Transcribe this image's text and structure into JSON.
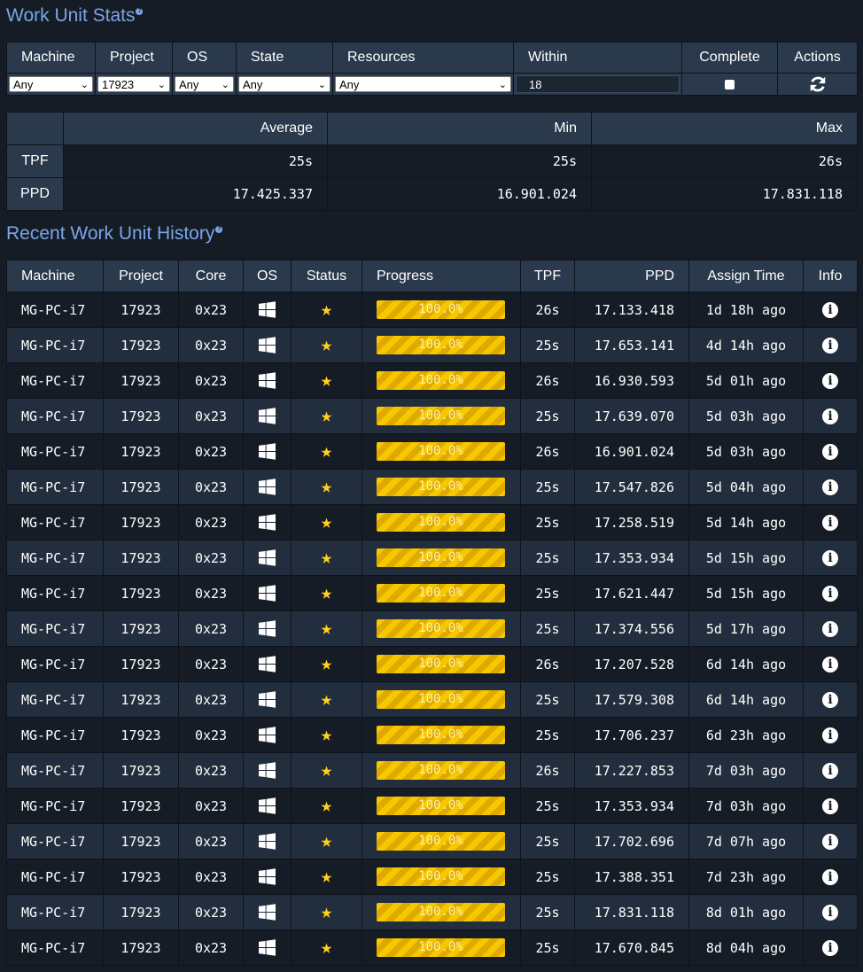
{
  "stats_section": {
    "title": "Work Unit Stats"
  },
  "filters": {
    "headers": {
      "machine": "Machine",
      "project": "Project",
      "os": "OS",
      "state": "State",
      "resources": "Resources",
      "within": "Within",
      "complete": "Complete",
      "actions": "Actions"
    },
    "values": {
      "machine": "Any",
      "project": "17923",
      "os": "Any",
      "state": "Any",
      "resources": "Any",
      "within": "18"
    },
    "complete_checked": false
  },
  "stats": {
    "headers": {
      "average": "Average",
      "min": "Min",
      "max": "Max"
    },
    "rows": [
      {
        "label": "TPF",
        "average": "25s",
        "min": "25s",
        "max": "26s"
      },
      {
        "label": "PPD",
        "average": "17.425.337",
        "min": "16.901.024",
        "max": "17.831.118"
      }
    ]
  },
  "history_section": {
    "title": "Recent Work Unit History"
  },
  "history": {
    "headers": {
      "machine": "Machine",
      "project": "Project",
      "core": "Core",
      "os": "OS",
      "status": "Status",
      "progress": "Progress",
      "tpf": "TPF",
      "ppd": "PPD",
      "assign_time": "Assign Time",
      "info": "Info"
    },
    "os_icon": "windows-icon",
    "status_icon": "star-icon",
    "info_icon": "info-icon",
    "progress_color": "#f5c800",
    "rows": [
      {
        "machine": "MG-PC-i7",
        "project": "17923",
        "core": "0x23",
        "progress": "100.0%",
        "tpf": "26s",
        "ppd": "17.133.418",
        "assign_time": "1d 18h ago"
      },
      {
        "machine": "MG-PC-i7",
        "project": "17923",
        "core": "0x23",
        "progress": "100.0%",
        "tpf": "25s",
        "ppd": "17.653.141",
        "assign_time": "4d 14h ago"
      },
      {
        "machine": "MG-PC-i7",
        "project": "17923",
        "core": "0x23",
        "progress": "100.0%",
        "tpf": "26s",
        "ppd": "16.930.593",
        "assign_time": "5d 01h ago"
      },
      {
        "machine": "MG-PC-i7",
        "project": "17923",
        "core": "0x23",
        "progress": "100.0%",
        "tpf": "25s",
        "ppd": "17.639.070",
        "assign_time": "5d 03h ago"
      },
      {
        "machine": "MG-PC-i7",
        "project": "17923",
        "core": "0x23",
        "progress": "100.0%",
        "tpf": "26s",
        "ppd": "16.901.024",
        "assign_time": "5d 03h ago"
      },
      {
        "machine": "MG-PC-i7",
        "project": "17923",
        "core": "0x23",
        "progress": "100.0%",
        "tpf": "25s",
        "ppd": "17.547.826",
        "assign_time": "5d 04h ago"
      },
      {
        "machine": "MG-PC-i7",
        "project": "17923",
        "core": "0x23",
        "progress": "100.0%",
        "tpf": "25s",
        "ppd": "17.258.519",
        "assign_time": "5d 14h ago"
      },
      {
        "machine": "MG-PC-i7",
        "project": "17923",
        "core": "0x23",
        "progress": "100.0%",
        "tpf": "25s",
        "ppd": "17.353.934",
        "assign_time": "5d 15h ago"
      },
      {
        "machine": "MG-PC-i7",
        "project": "17923",
        "core": "0x23",
        "progress": "100.0%",
        "tpf": "25s",
        "ppd": "17.621.447",
        "assign_time": "5d 15h ago"
      },
      {
        "machine": "MG-PC-i7",
        "project": "17923",
        "core": "0x23",
        "progress": "100.0%",
        "tpf": "25s",
        "ppd": "17.374.556",
        "assign_time": "5d 17h ago"
      },
      {
        "machine": "MG-PC-i7",
        "project": "17923",
        "core": "0x23",
        "progress": "100.0%",
        "tpf": "26s",
        "ppd": "17.207.528",
        "assign_time": "6d 14h ago"
      },
      {
        "machine": "MG-PC-i7",
        "project": "17923",
        "core": "0x23",
        "progress": "100.0%",
        "tpf": "25s",
        "ppd": "17.579.308",
        "assign_time": "6d 14h ago"
      },
      {
        "machine": "MG-PC-i7",
        "project": "17923",
        "core": "0x23",
        "progress": "100.0%",
        "tpf": "25s",
        "ppd": "17.706.237",
        "assign_time": "6d 23h ago"
      },
      {
        "machine": "MG-PC-i7",
        "project": "17923",
        "core": "0x23",
        "progress": "100.0%",
        "tpf": "26s",
        "ppd": "17.227.853",
        "assign_time": "7d 03h ago"
      },
      {
        "machine": "MG-PC-i7",
        "project": "17923",
        "core": "0x23",
        "progress": "100.0%",
        "tpf": "25s",
        "ppd": "17.353.934",
        "assign_time": "7d 03h ago"
      },
      {
        "machine": "MG-PC-i7",
        "project": "17923",
        "core": "0x23",
        "progress": "100.0%",
        "tpf": "25s",
        "ppd": "17.702.696",
        "assign_time": "7d 07h ago"
      },
      {
        "machine": "MG-PC-i7",
        "project": "17923",
        "core": "0x23",
        "progress": "100.0%",
        "tpf": "25s",
        "ppd": "17.388.351",
        "assign_time": "7d 23h ago"
      },
      {
        "machine": "MG-PC-i7",
        "project": "17923",
        "core": "0x23",
        "progress": "100.0%",
        "tpf": "25s",
        "ppd": "17.831.118",
        "assign_time": "8d 01h ago"
      },
      {
        "machine": "MG-PC-i7",
        "project": "17923",
        "core": "0x23",
        "progress": "100.0%",
        "tpf": "25s",
        "ppd": "17.670.845",
        "assign_time": "8d 04h ago"
      }
    ]
  }
}
